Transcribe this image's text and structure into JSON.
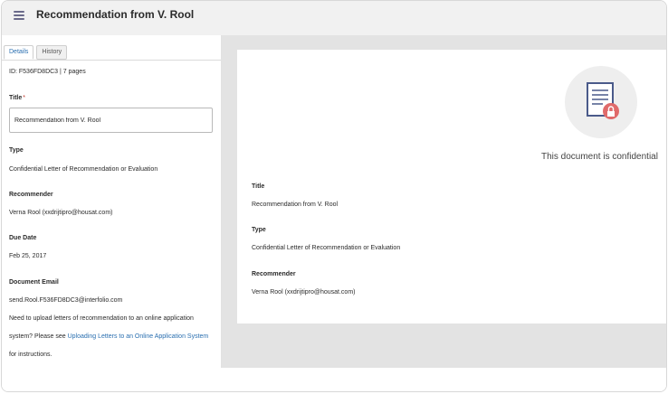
{
  "header": {
    "title": "Recommendation from V. Rool"
  },
  "tabs": [
    "Details",
    "History"
  ],
  "details": {
    "id_line": "ID: F536FD8DC3 | 7 pages",
    "title_label": "Title",
    "title_required": "*",
    "title_value": "Recommendation from V. Rool",
    "type_label": "Type",
    "type_value": "Confidential Letter of Recommendation or Evaluation",
    "recommender_label": "Recommender",
    "recommender_value": "Verna Rool (xxdrijtipro@housat.com)",
    "due_label": "Due Date",
    "due_value": "Feb 25, 2017",
    "email_label": "Document Email",
    "email_value": "send.Rool.F536FD8DC3@interfolio.com",
    "help_line1": "Need to upload letters of recommendation to an online application",
    "help_line2_prefix": "system? Please see ",
    "help_link": "Uploading Letters to an Online Application System",
    "help_line3": "for instructions."
  },
  "document_view": {
    "confidential_text": "This document is confidential",
    "title_label": "Title",
    "title_value": "Recommendation from V. Rool",
    "type_label": "Type",
    "type_value": "Confidential Letter of Recommendation or Evaluation",
    "recommender_label": "Recommender",
    "recommender_value": "Verna Rool (xxdrijtipro@housat.com)"
  },
  "colors": {
    "link": "#2a6fb0",
    "lock_badge": "#e06a6a",
    "doc_icon": "#4a5a8a"
  }
}
